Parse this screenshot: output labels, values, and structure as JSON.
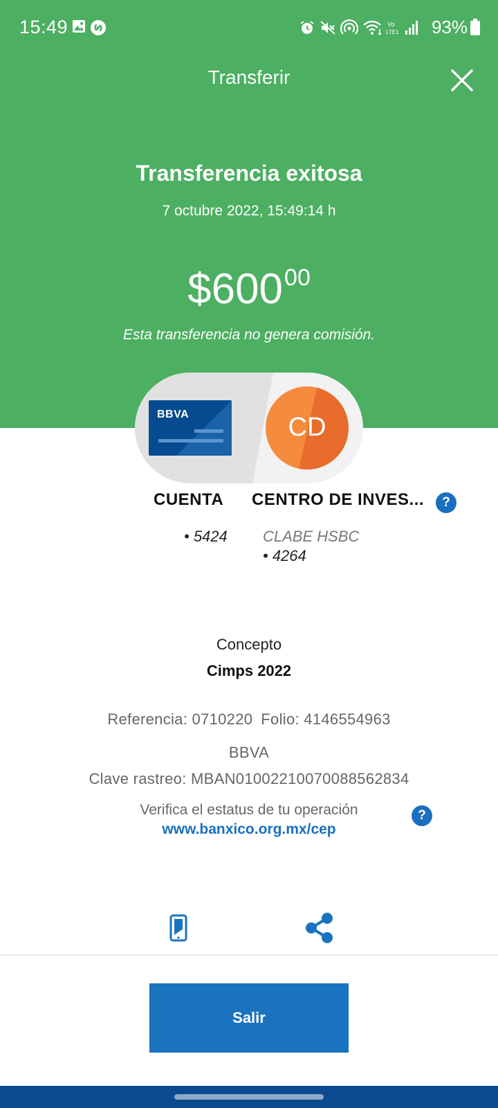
{
  "status_bar": {
    "time": "15:49",
    "battery": "93%",
    "icons": [
      "image-icon",
      "shazam-icon",
      "alarm-icon",
      "mute-icon",
      "hotspot-icon",
      "wifi-icon",
      "volte-icon",
      "signal-icon",
      "battery-icon"
    ]
  },
  "header": {
    "title": "Transferir",
    "close_icon": "close-icon"
  },
  "result": {
    "title": "Transferencia exitosa",
    "date": "7 octubre 2022, 15:49:14 h",
    "amount_main": "$600",
    "amount_cents": "00",
    "commission_note": "Esta transferencia no genera comisión."
  },
  "from_account": {
    "card_brand": "BBVA",
    "label": "CUENTA",
    "number": "• 5424"
  },
  "to_account": {
    "avatar_initials": "CD",
    "label": "CENTRO DE INVES...",
    "bank": "CLABE HSBC",
    "number": "• 4264",
    "help_icon": "?"
  },
  "details": {
    "concept_label": "Concepto",
    "concept_value": "Cimps 2022",
    "reference": "Referencia: 0710220",
    "folio": "Folio: 4146554963",
    "bank": "BBVA",
    "tracking_key": "Clave rastreo: MBAN01002210070088562834",
    "verify_text": "Verifica el estatus de tu operación",
    "verify_link": "www.banxico.org.mx/cep",
    "help_icon": "?"
  },
  "actions": {
    "save_icon": "save-to-phone-icon",
    "share_icon": "share-icon"
  },
  "footer": {
    "exit_label": "Salir"
  },
  "colors": {
    "hero_green": "#4caf62",
    "primary_blue": "#1a73bf",
    "nav_blue": "#0b4a8e",
    "avatar_orange": "#f58b3d"
  }
}
